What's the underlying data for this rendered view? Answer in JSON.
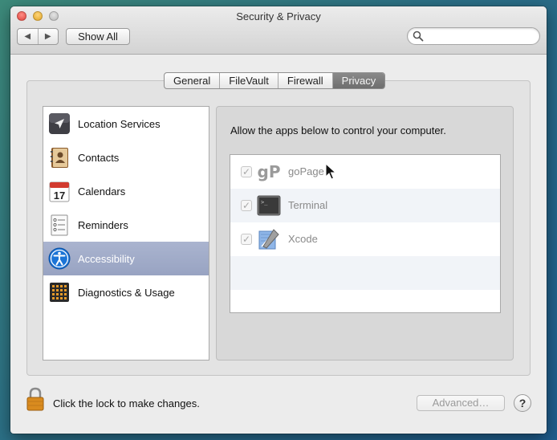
{
  "window": {
    "title": "Security & Privacy",
    "controls": {
      "close": "close-button",
      "minimize": "minimize-button",
      "zoom": "zoom-button"
    }
  },
  "toolbar": {
    "back_glyph": "◀",
    "forward_glyph": "▶",
    "show_all_label": "Show All",
    "search": {
      "placeholder": "",
      "value": ""
    }
  },
  "tabs": [
    {
      "label": "General",
      "active": false
    },
    {
      "label": "FileVault",
      "active": false
    },
    {
      "label": "Firewall",
      "active": false
    },
    {
      "label": "Privacy",
      "active": true
    }
  ],
  "sidebar": {
    "items": [
      {
        "label": "Location Services",
        "icon": "location-arrow-icon"
      },
      {
        "label": "Contacts",
        "icon": "contacts-book-icon"
      },
      {
        "label": "Calendars",
        "icon": "calendar-icon",
        "calendar_day": "17"
      },
      {
        "label": "Reminders",
        "icon": "reminders-list-icon"
      },
      {
        "label": "Accessibility",
        "icon": "accessibility-icon",
        "selected": true
      },
      {
        "label": "Diagnostics & Usage",
        "icon": "diagnostics-grid-icon"
      }
    ]
  },
  "panel": {
    "instruction": "Allow the apps below to control your computer.",
    "apps": [
      {
        "name": "goPage",
        "icon": "gopage-icon",
        "icon_text": "gP",
        "checked": true,
        "enabled": false
      },
      {
        "name": "Terminal",
        "icon": "terminal-icon",
        "icon_text": ">_",
        "checked": true,
        "enabled": false
      },
      {
        "name": "Xcode",
        "icon": "xcode-icon",
        "checked": true,
        "enabled": false
      }
    ]
  },
  "footer": {
    "lock_text": "Click the lock to make changes.",
    "advanced_label": "Advanced…",
    "help_label": "?"
  },
  "colors": {
    "selection": "#9ea8c6",
    "window_bg": "#ececec",
    "disabled_text": "#8a8a8a",
    "accessibility_blue": "#1b74d6",
    "lock_orange": "#d98b1f"
  }
}
